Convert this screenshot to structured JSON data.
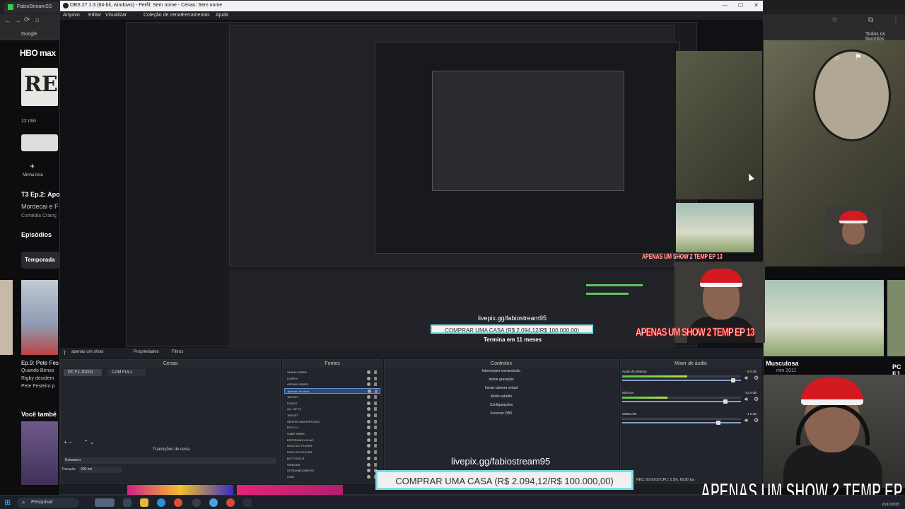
{
  "browser": {
    "tab_title": "FabioStreamSS",
    "bookmarks": [
      "Google",
      "Todos os favoritos"
    ],
    "logo": "HBO max",
    "show_title": "T3 Ep.2: Apo",
    "show_sub": "Mordecai e F",
    "genre": "Comédia Crianç",
    "episodes_label": "Episódios",
    "season_label": "Temporada",
    "minutes": "12 min",
    "my_list": "Minha lista",
    "ep9_title": "Ep.9: Pete Fes",
    "ep9_line1": "Quando Benso",
    "ep9_line2": "Rigby decidem",
    "ep9_line3": "Pete Festeiro p",
    "you_also": "Você també",
    "right_title": "Musculosa",
    "right_sub": "min  2011",
    "right_pc": "PC FJ"
  },
  "obs": {
    "title": "OBS 27.1.3 (64-bit, windows) - Perfil: Sem nome - Cenas: Sem nome",
    "menu": [
      "Arquivo",
      "Editar",
      "Visualizar",
      "Coleção de cenas",
      "Ferramentas",
      "Ajuda"
    ],
    "tools": [
      "apenas um show",
      "Propriedades",
      "Filtros"
    ],
    "docks": {
      "scenes": "Cenas",
      "sources": "Fontes",
      "controls": "Controles",
      "mixer": "Mixer de áudio"
    },
    "scenes": [
      "PC FJ JOGO",
      "CAM FULL"
    ],
    "sources": [
      "VENHA VERPA",
      "LIVEPIX",
      "APENAS RIDER",
      "apenas um show",
      "TARGET",
      "FUNDO",
      "ALL GIFTS",
      "TARGET",
      "SENTER INSCRIPTIONS",
      "BITS 2.0",
      "GAME WEBS",
      "ESPERANDO ACAO",
      "NOVO DO PLAYER",
      "NOVO DO PLAYER",
      "BOT STATUS",
      "WEBCAM",
      "STREAMELEMENTS",
      "CHAT"
    ],
    "controls": [
      "Interromper transmissão",
      "Iniciar gravação",
      "Iniciar câmera virtual",
      "Modo estúdio",
      "Configurações",
      "Encerrar OBS"
    ],
    "mixer": [
      {
        "name": "Áudio do desktop",
        "db": "-6.0 dB",
        "level": 0.55,
        "fader": 0.95
      },
      {
        "name": "Mic/Aux",
        "db": "-12.0 dB",
        "level": 0.38,
        "fader": 0.88
      },
      {
        "name": "WEBCAM",
        "db": "-1.8 dB",
        "level": 0.0,
        "fader": 0.82
      }
    ],
    "transitions": "Transições de cena",
    "transition_value": "Esmaecer",
    "duration_label": "Duração",
    "duration_value": "300 ms",
    "status": "REC: 00:00:00    CPU: 2.5%, 60.00 fps"
  },
  "overlay": {
    "livepix": "livepix.gg/fabiostream95",
    "comprar": "COMPRAR UMA CASA (R$ 2.094,12/R$ 100.000,00)",
    "termina": "Termina em 11 meses",
    "apenas": "APENAS UM SHOW 2 TEMP EP 13"
  },
  "taskbar": {
    "search": "Pesquisar",
    "time": "",
    "date": "23/12/2025"
  },
  "colors": {
    "accent_cyan": "#79dbe6",
    "hat_red": "#d41a20",
    "meter_green": "#4cc54c"
  }
}
